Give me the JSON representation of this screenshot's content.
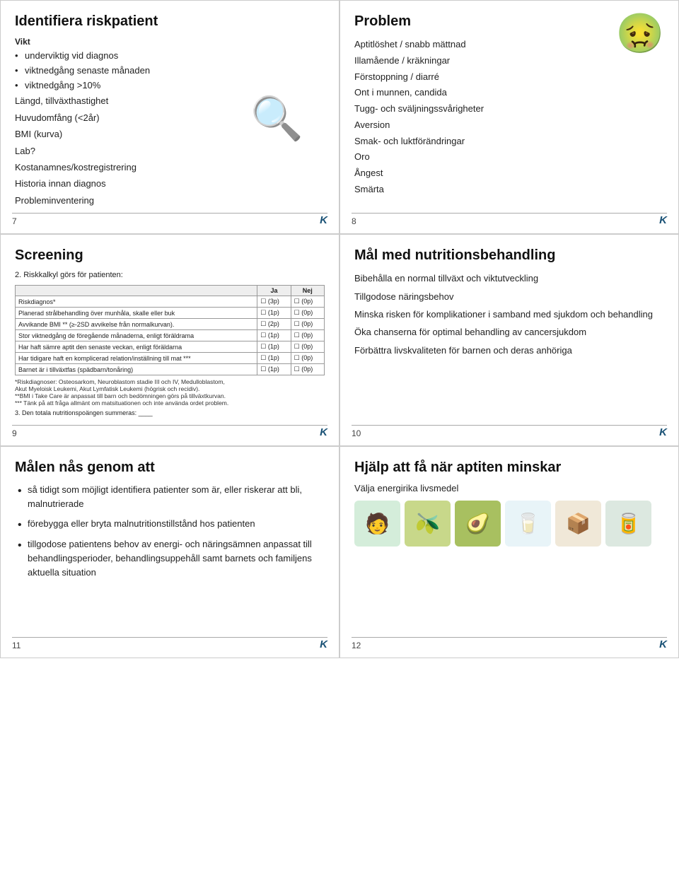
{
  "slides": {
    "slide7": {
      "number": "7",
      "title": "Identifiera riskpatient",
      "sections": [
        {
          "label": "Vikt",
          "items": [
            "underviktig vid diagnos",
            "viktnedgång senaste månaden",
            "viktnedgång >10%"
          ]
        },
        {
          "label": "Längd, tillväxthastighet",
          "items": []
        },
        {
          "label": "Huvudomfång (<2år)",
          "items": []
        },
        {
          "label": "BMI (kurva)",
          "items": []
        },
        {
          "label": "Lab?",
          "items": []
        },
        {
          "label": "Kostanamnes/kostregistrering",
          "items": []
        },
        {
          "label": "Historia innan diagnos",
          "items": []
        },
        {
          "label": "Probleminventering",
          "items": []
        }
      ],
      "k_label": "K"
    },
    "slide8": {
      "number": "8",
      "title": "Problem",
      "items": [
        "Aptitlöshet / snabb mättnad",
        "Illamående / kräkningar",
        "Förstoppning / diarré",
        "Ont i munnen, candida",
        "Tugg- och sväljningssvårigheter",
        "Aversion",
        "Smak- och luktförändringar",
        "Oro",
        "Ångest",
        "Smärta"
      ],
      "k_label": "K"
    },
    "slide9": {
      "number": "9",
      "title": "Screening",
      "subtitle": "2. Riskkalkyl görs för patienten:",
      "table": {
        "headers": [
          "",
          "Ja",
          "Nej"
        ],
        "rows": [
          [
            "Riskdiagnos*",
            "(3p)",
            "(0p)"
          ],
          [
            "Planerad strålbehandling över munhåla, skalle eller buk",
            "(1p)",
            "(0p)"
          ],
          [
            "Avvikande BMI ** (≥-2SD avvikelse från normalkurvan).",
            "(2p)",
            "(0p)"
          ],
          [
            "Stor viktnedgång de föregående månaderna, enligt föräldrama",
            "(1p)",
            "(0p)"
          ],
          [
            "Har haft sämre aptit den senaste veckan, enligt föräldarna",
            "(1p)",
            "(0p)"
          ],
          [
            "Har tidigare haft en komplicerad relation/inställning till mat ***",
            "(1p)",
            "(0p)"
          ],
          [
            "Barnet är i tillväxtfas (spädbarn/tonåring)",
            "(1p)",
            "(0p)"
          ]
        ],
        "notes": [
          "*Riskdiagnoser: Osteosarkom, Neuroblastom stadie III och IV, Medulloblastom,",
          "Akut Myeloisk Leukemi, Akut Lymfatisk Leukemi (högrisk och recidiv).",
          "**BMI i Take Care är anpassat till barn och bedömningen görs på tillväxtkurvan.",
          "*** Tänk på att fråga allmänt om matsituationen och inte använda ordet problem."
        ],
        "sum_label": "3. Den totala nutritionspoängen summeras:"
      },
      "k_label": "K"
    },
    "slide10": {
      "number": "10",
      "title": "Mål med nutritionsbehandling",
      "items": [
        "Bibehålla en normal tillväxt och viktutveckling",
        "Tillgodose näringsbehov",
        "Minska risken för komplikationer i samband med sjukdom och behandling",
        "Öka chanserna för optimal behandling av cancersjukdom",
        "Förbättra livskvaliteten för barnen och deras anhöriga"
      ],
      "k_label": "K"
    },
    "slide11": {
      "number": "11",
      "title": "Målen nås genom att",
      "items": [
        "så tidigt som möjligt identifiera patienter som är, eller riskerar att bli, malnutrierade",
        "förebygga eller bryta malnutritionstillstånd hos patienten",
        "tillgodose patientens behov av energi- och näringsämnen anpassat till behandlingsperioder, behandlingsuppehåll samt barnets och familjens aktuella situation"
      ],
      "k_label": "K"
    },
    "slide12": {
      "number": "12",
      "title": "Hjälp att få när aptiten minskar",
      "subtitle": "Välja energirika livsmedel",
      "food_items": [
        {
          "emoji": "🧑",
          "color": "green",
          "label": "person-icon"
        },
        {
          "emoji": "🫒",
          "color": "olive",
          "label": "olives"
        },
        {
          "emoji": "🥑",
          "color": "avocado",
          "label": "avocado"
        },
        {
          "emoji": "🥛",
          "color": "milk",
          "label": "milk"
        },
        {
          "emoji": "📦",
          "color": "package",
          "label": "package"
        },
        {
          "emoji": "🥫",
          "color": "can",
          "label": "can"
        }
      ],
      "k_label": "K"
    }
  }
}
